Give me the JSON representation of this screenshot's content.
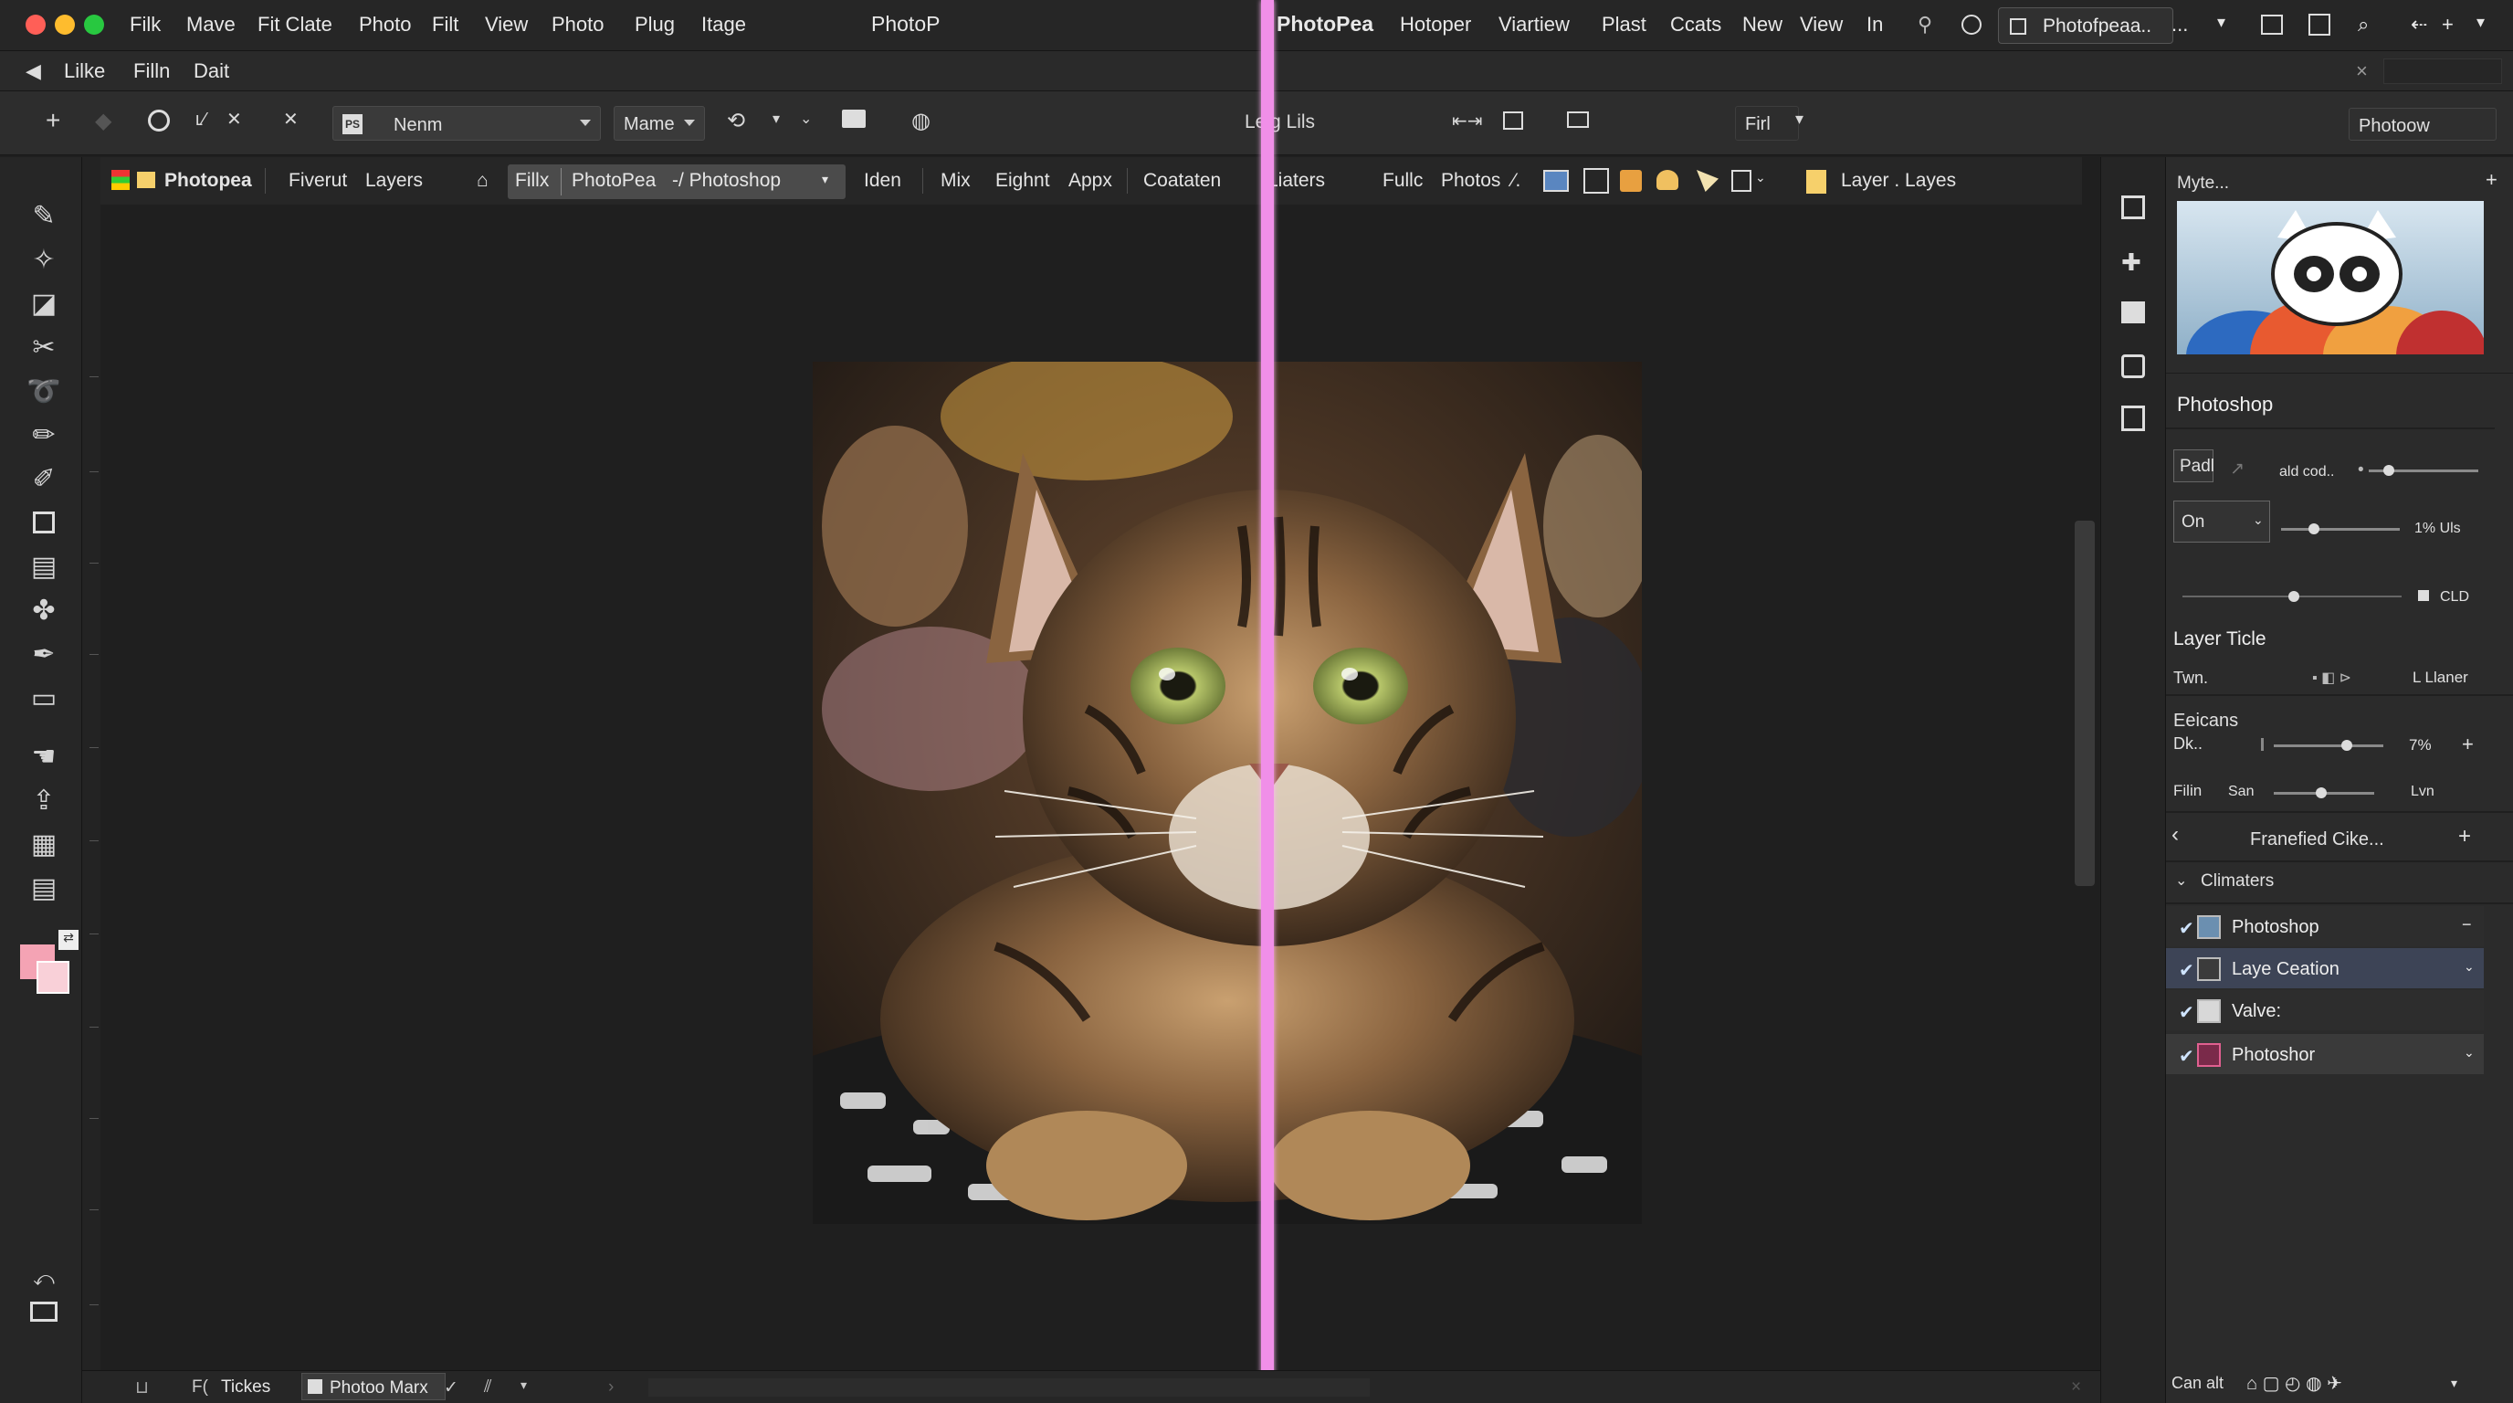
{
  "menubar": {
    "items_left": [
      "Filk",
      "Mave",
      "Fit Clate",
      "Photo",
      "Filt",
      "View",
      "Photo",
      "Plug",
      "Itage"
    ],
    "app_title_left": "PhotoP",
    "app_title_right": "PhotoPea",
    "items_right": [
      "Hotoper",
      "Viartiew",
      "Plast",
      "Ccats",
      "New",
      "View",
      "In"
    ],
    "window_tab": "Photofpeaa..",
    "more": "..."
  },
  "bar2": {
    "back": "Lilke",
    "item1": "Filln",
    "item2": "Dait",
    "close": "×"
  },
  "options": {
    "preset_value": "Nenm",
    "mode_value": "Mame",
    "center_label": "Lelg Lils",
    "right_select": "Firl",
    "right_field": "Photoow"
  },
  "tabs": {
    "brand": "Photopea",
    "t1": "Fiverut",
    "t2": "Layers",
    "t3": "Fillx",
    "t4": "PhotoPea",
    "t5": "-/ Photoshop",
    "t6": "Iden",
    "t7": "Mix",
    "t8": "Eighnt",
    "t9": "Appx",
    "t10": "Coataten",
    "t11": "Liaters",
    "t12": "Fullc",
    "t13": "Photos",
    "t14": "Layer . Layes"
  },
  "panel": {
    "preview_title": "Myte...",
    "section_title": "Photoshop",
    "pad_label": "Padl",
    "sub_label": "ald cod..",
    "blend_value": "On",
    "pct1": "1% Uls",
    "cld": "CLD",
    "layer_title": "Layer Ticle",
    "twn": "Twn.",
    "llaner": "L Llaner",
    "decans": "Eeicans",
    "dk": "Dk..",
    "pct2": "7%",
    "filin": "Filin",
    "san": "San",
    "lvn": "Lvn",
    "nav_title": "Franefied Cike...",
    "climaters": "Climaters",
    "layers": [
      {
        "name": "Photoshop",
        "active": false
      },
      {
        "name": "Laye Ceation",
        "active": true
      },
      {
        "name": "Valve:",
        "active": false
      },
      {
        "name": "Photoshor",
        "active": true
      }
    ],
    "footer": "Can alt"
  },
  "bottom": {
    "ticks": "Tickes",
    "doc": "Photoo Marx"
  },
  "colors": {
    "accent": "#f08fe8",
    "foreground": "#f4a3b4",
    "selection": "#3d4456"
  }
}
